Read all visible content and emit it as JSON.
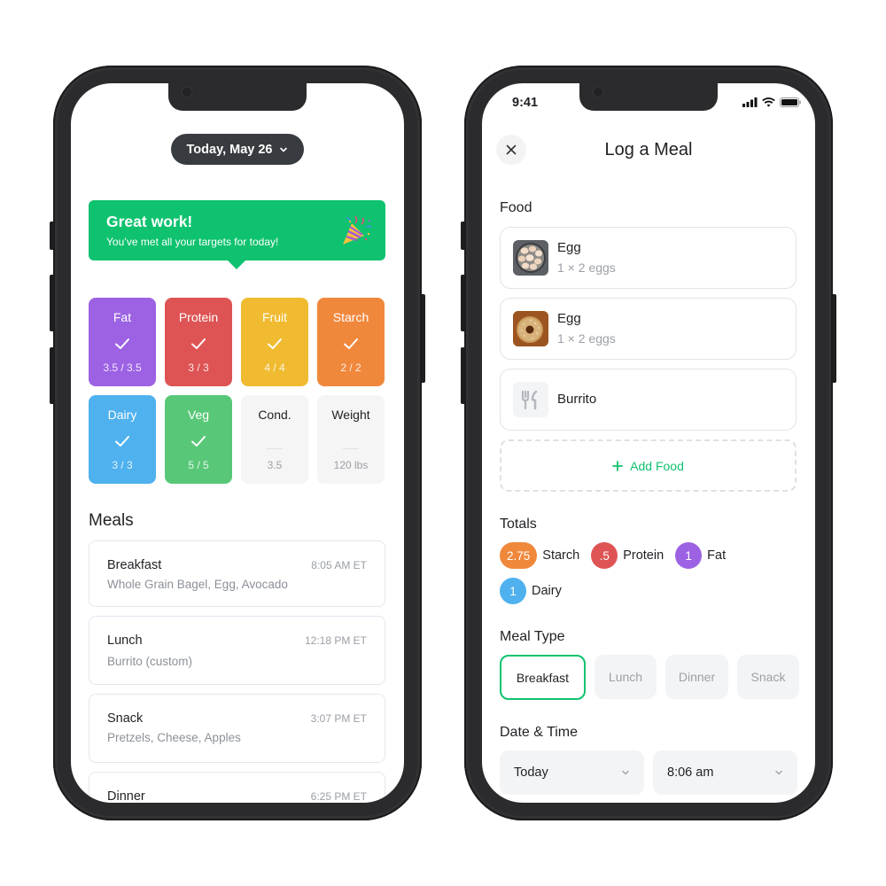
{
  "left_screen": {
    "date_selector": {
      "label": "Today, May 26",
      "icon": "chevron-down-icon"
    },
    "banner": {
      "title": "Great work!",
      "subtitle": "You’ve met all your targets for today!",
      "icon": "party-popper-icon",
      "color": "#0fc26f"
    },
    "targets": [
      {
        "name": "Fat",
        "value": "3.5 / 3.5",
        "met": true,
        "color": "#9c62e3"
      },
      {
        "name": "Protein",
        "value": "3 / 3",
        "met": true,
        "color": "#de5454"
      },
      {
        "name": "Fruit",
        "value": "4 / 4",
        "met": true,
        "color": "#f0bb30"
      },
      {
        "name": "Starch",
        "value": "2 / 2",
        "met": true,
        "color": "#f0883c"
      },
      {
        "name": "Dairy",
        "value": "3 / 3",
        "met": true,
        "color": "#4fb1ee"
      },
      {
        "name": "Veg",
        "value": "5 / 5",
        "met": true,
        "color": "#58c878"
      },
      {
        "name": "Cond.",
        "value": "3.5",
        "met": false,
        "color": "#f5f5f5"
      },
      {
        "name": "Weight",
        "value": "120 lbs",
        "met": false,
        "color": "#f5f5f5"
      }
    ],
    "meals_title": "Meals",
    "meals": [
      {
        "name": "Breakfast",
        "time": "8:05 AM ET",
        "items": "Whole Grain Bagel, Egg, Avocado"
      },
      {
        "name": "Lunch",
        "time": "12:18 PM ET",
        "items": "Burrito (custom)"
      },
      {
        "name": "Snack",
        "time": "3:07 PM ET",
        "items": "Pretzels, Cheese, Apples"
      },
      {
        "name": "Dinner",
        "time": "6:25 PM ET",
        "items": ""
      }
    ]
  },
  "right_screen": {
    "status_bar": {
      "time": "9:41",
      "icons": [
        "cellular-signal-icon",
        "wifi-icon",
        "battery-icon"
      ]
    },
    "title": "Log a Meal",
    "close_icon": "close-icon",
    "food_label": "Food",
    "foods": [
      {
        "name": "Egg",
        "quantity": "1 × 2 eggs",
        "image": "eggs-photo"
      },
      {
        "name": "Egg",
        "quantity": "1 × 2 eggs",
        "image": "bagel-photo"
      },
      {
        "name": "Burrito",
        "quantity": "",
        "image": "fork-knife-icon"
      }
    ],
    "add_food_label": "Add Food",
    "totals_label": "Totals",
    "totals": [
      {
        "value": "2.75",
        "label": "Starch",
        "color": "#f0883c"
      },
      {
        "value": ".5",
        "label": "Protein",
        "color": "#de5454"
      },
      {
        "value": "1",
        "label": "Fat",
        "color": "#9c62e3"
      },
      {
        "value": "1",
        "label": "Dairy",
        "color": "#4fb1ee"
      }
    ],
    "meal_type_label": "Meal Type",
    "meal_types": [
      {
        "label": "Breakfast",
        "selected": true
      },
      {
        "label": "Lunch",
        "selected": false
      },
      {
        "label": "Dinner",
        "selected": false
      },
      {
        "label": "Snack",
        "selected": false
      }
    ],
    "date_time_label": "Date & Time",
    "date_value": "Today",
    "time_value": "8:06 am",
    "accent": "#10c26f"
  }
}
